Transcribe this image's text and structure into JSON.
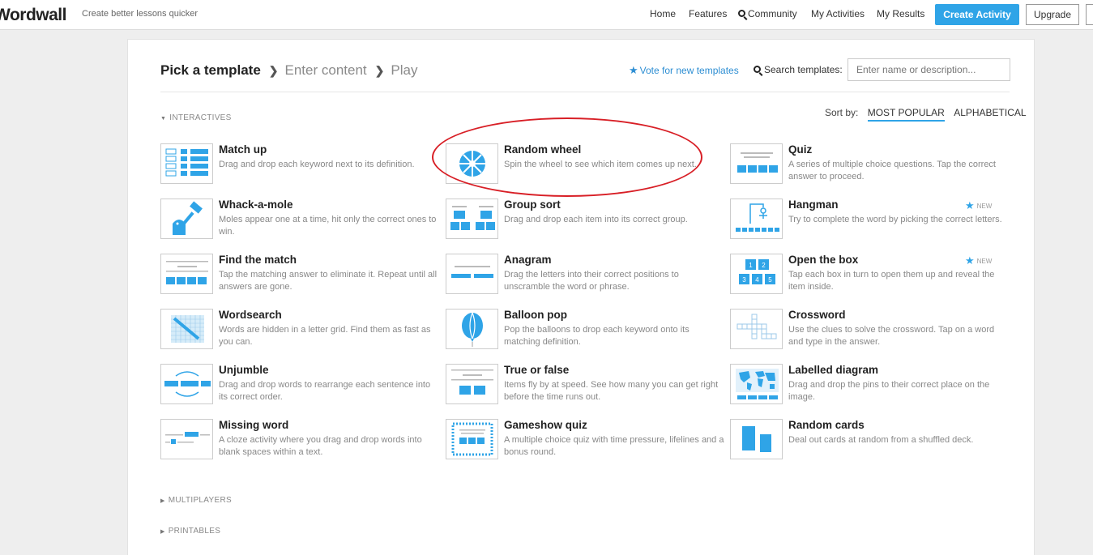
{
  "app": {
    "logo": "Wordwall",
    "tagline": "Create better lessons quicker"
  },
  "nav": {
    "home": "Home",
    "features": "Features",
    "community": "Community",
    "my_activities": "My Activities",
    "my_results": "My Results",
    "create_activity": "Create Activity",
    "upgrade": "Upgrade"
  },
  "steps": {
    "pick": "Pick a template",
    "enter": "Enter content",
    "play": "Play"
  },
  "vote_link": "Vote for new templates",
  "search": {
    "label": "Search templates:",
    "placeholder": "Enter name or description..."
  },
  "sections": {
    "interactives": "INTERACTIVES",
    "multiplayers": "MULTIPLAYERS",
    "printables": "PRINTABLES"
  },
  "sort": {
    "label": "Sort by:",
    "most_popular": "MOST POPULAR",
    "alphabetical": "ALPHABETICAL"
  },
  "new_badge": "NEW",
  "accent_color": "#2fa4e7",
  "highlight_color": "#d81f26",
  "templates": [
    {
      "name": "Match up",
      "desc": "Drag and drop each keyword next to its definition.",
      "icon": "match-up-icon"
    },
    {
      "name": "Random wheel",
      "desc": "Spin the wheel to see which item comes up next.",
      "icon": "random-wheel-icon"
    },
    {
      "name": "Quiz",
      "desc": "A series of multiple choice questions. Tap the correct answer to proceed.",
      "icon": "quiz-icon"
    },
    {
      "name": "Whack-a-mole",
      "desc": "Moles appear one at a time, hit only the correct ones to win.",
      "icon": "whack-a-mole-icon"
    },
    {
      "name": "Group sort",
      "desc": "Drag and drop each item into its correct group.",
      "icon": "group-sort-icon"
    },
    {
      "name": "Hangman",
      "desc": "Try to complete the word by picking the correct letters.",
      "icon": "hangman-icon",
      "new": true
    },
    {
      "name": "Find the match",
      "desc": "Tap the matching answer to eliminate it. Repeat until all answers are gone.",
      "icon": "find-the-match-icon"
    },
    {
      "name": "Anagram",
      "desc": "Drag the letters into their correct positions to unscramble the word or phrase.",
      "icon": "anagram-icon"
    },
    {
      "name": "Open the box",
      "desc": "Tap each box in turn to open them up and reveal the item inside.",
      "icon": "open-the-box-icon",
      "new": true
    },
    {
      "name": "Wordsearch",
      "desc": "Words are hidden in a letter grid. Find them as fast as you can.",
      "icon": "wordsearch-icon"
    },
    {
      "name": "Balloon pop",
      "desc": "Pop the balloons to drop each keyword onto its matching definition.",
      "icon": "balloon-pop-icon"
    },
    {
      "name": "Crossword",
      "desc": "Use the clues to solve the crossword. Tap on a word and type in the answer.",
      "icon": "crossword-icon"
    },
    {
      "name": "Unjumble",
      "desc": "Drag and drop words to rearrange each sentence into its correct order.",
      "icon": "unjumble-icon"
    },
    {
      "name": "True or false",
      "desc": "Items fly by at speed. See how many you can get right before the time runs out.",
      "icon": "true-or-false-icon"
    },
    {
      "name": "Labelled diagram",
      "desc": "Drag and drop the pins to their correct place on the image.",
      "icon": "labelled-diagram-icon"
    },
    {
      "name": "Missing word",
      "desc": "A cloze activity where you drag and drop words into blank spaces within a text.",
      "icon": "missing-word-icon"
    },
    {
      "name": "Gameshow quiz",
      "desc": "A multiple choice quiz with time pressure, lifelines and a bonus round.",
      "icon": "gameshow-quiz-icon"
    },
    {
      "name": "Random cards",
      "desc": "Deal out cards at random from a shuffled deck.",
      "icon": "random-cards-icon"
    }
  ]
}
